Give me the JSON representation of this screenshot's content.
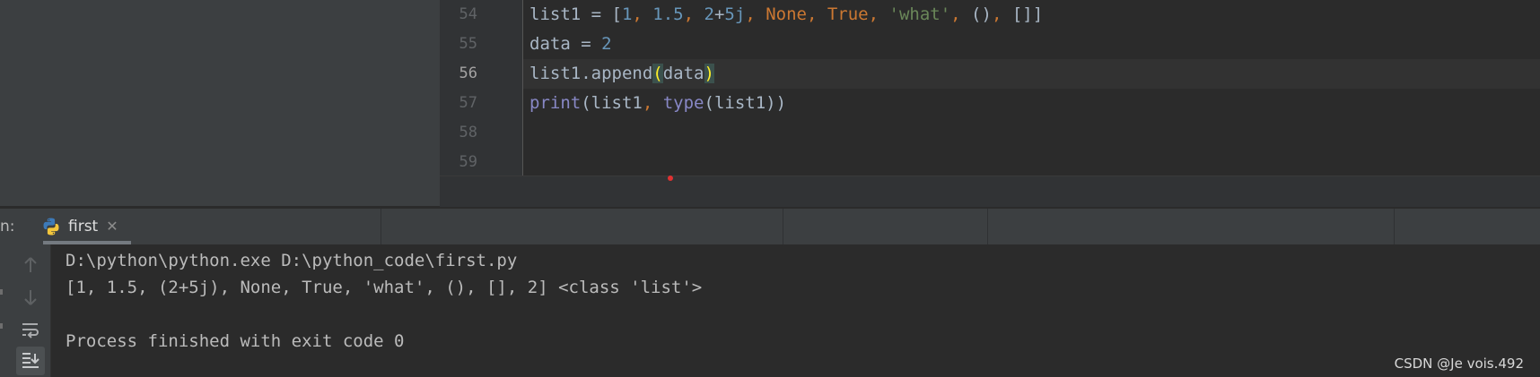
{
  "editor": {
    "line_numbers": [
      "54",
      "55",
      "56",
      "57",
      "58",
      "59"
    ],
    "current_line": "56",
    "lines": [
      {
        "tokens": [
          {
            "t": "list1 = [",
            "c": "plain"
          },
          {
            "t": "1",
            "c": "num"
          },
          {
            "t": ", ",
            "c": "kw"
          },
          {
            "t": "1.5",
            "c": "num"
          },
          {
            "t": ", ",
            "c": "kw"
          },
          {
            "t": "2",
            "c": "num"
          },
          {
            "t": "+",
            "c": "plain"
          },
          {
            "t": "5j",
            "c": "num"
          },
          {
            "t": ", ",
            "c": "kw"
          },
          {
            "t": "None",
            "c": "kw"
          },
          {
            "t": ", ",
            "c": "kw"
          },
          {
            "t": "True",
            "c": "kw"
          },
          {
            "t": ", ",
            "c": "kw"
          },
          {
            "t": "'what'",
            "c": "str"
          },
          {
            "t": ", ",
            "c": "kw"
          },
          {
            "t": "()",
            "c": "plain"
          },
          {
            "t": ", ",
            "c": "kw"
          },
          {
            "t": "[]]",
            "c": "plain"
          }
        ]
      },
      {
        "tokens": [
          {
            "t": "data = ",
            "c": "plain"
          },
          {
            "t": "2",
            "c": "num"
          }
        ]
      },
      {
        "tokens": [
          {
            "t": "list1.append",
            "c": "plain"
          },
          {
            "t": "(",
            "c": "paren-hl"
          },
          {
            "t": "data",
            "c": "plain"
          },
          {
            "t": ")",
            "c": "paren-hl"
          }
        ]
      },
      {
        "tokens": [
          {
            "t": "print",
            "c": "builtin"
          },
          {
            "t": "(list1",
            "c": "plain"
          },
          {
            "t": ", ",
            "c": "kw"
          },
          {
            "t": "type",
            "c": "builtin"
          },
          {
            "t": "(list1))",
            "c": "plain"
          }
        ]
      },
      {
        "tokens": []
      },
      {
        "tokens": []
      }
    ]
  },
  "run_panel": {
    "label": "n:",
    "tab_label": "first",
    "close_glyph": "✕",
    "tab_icon": "python-icon"
  },
  "toolbar": {
    "icons": [
      "arrow-up-icon",
      "arrow-down-icon",
      "soft-wrap-icon",
      "scroll-to-end-icon"
    ]
  },
  "console": {
    "lines": [
      "D:\\python\\python.exe D:\\python_code\\first.py",
      "[1, 1.5, (2+5j), None, True, 'what', (), [], 2] <class 'list'>",
      "",
      "Process finished with exit code 0"
    ]
  },
  "watermark": "CSDN @Je vois.492",
  "colors": {
    "background": "#2b2b2b",
    "panel": "#3c3f41",
    "number": "#6897bb",
    "keyword": "#cc7832",
    "string": "#6a8759",
    "builtin": "#8888c6",
    "text": "#a9b7c6",
    "brace_match": "#ffef28"
  }
}
